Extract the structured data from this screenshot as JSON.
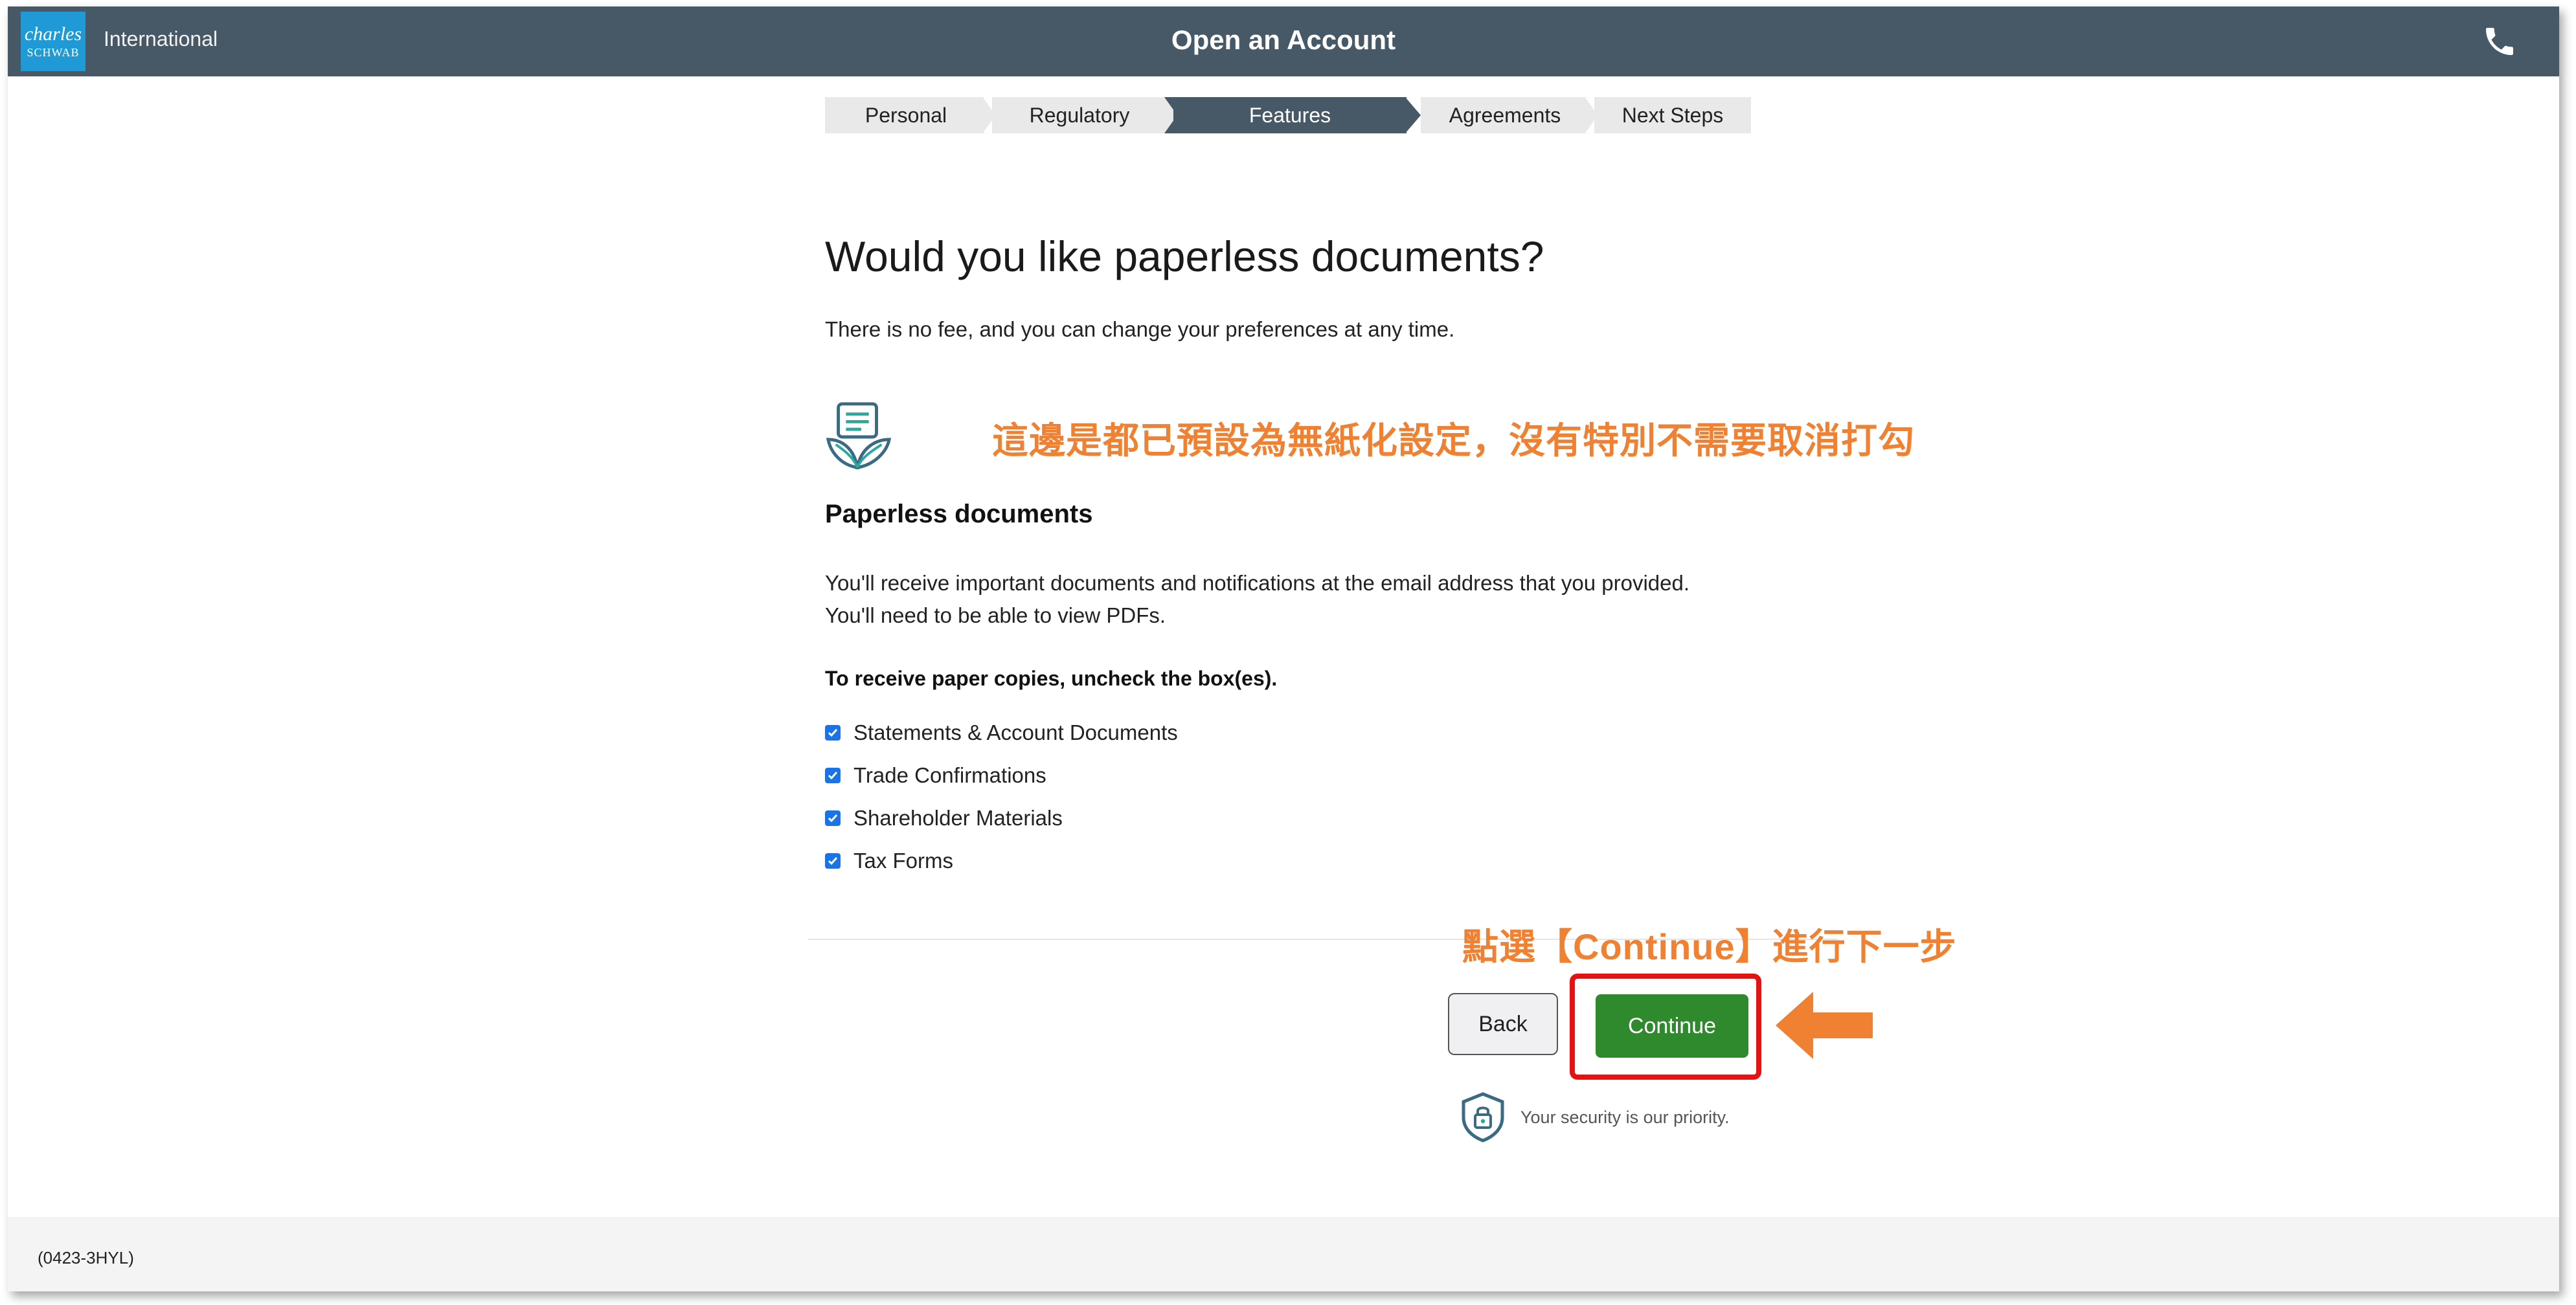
{
  "header": {
    "logo_line1": "charles",
    "logo_line2": "SCHWAB",
    "region": "International",
    "title": "Open an Account",
    "phone_icon": "phone-icon"
  },
  "stepper": {
    "steps": [
      {
        "label": "Personal",
        "active": false
      },
      {
        "label": "Regulatory",
        "active": false
      },
      {
        "label": "Features",
        "active": true
      },
      {
        "label": "Agreements",
        "active": false
      },
      {
        "label": "Next Steps",
        "active": false
      }
    ]
  },
  "main": {
    "question": "Would you like paperless documents?",
    "subtitle": "There is no fee, and you can change your preferences at any time.",
    "annotation_default": "這邊是都已預設為無紙化設定，沒有特別不需要取消打勾",
    "section_title": "Paperless documents",
    "description_line1": "You'll receive important documents and notifications at the email address that you provided.",
    "description_line2": "You'll need to be able to view PDFs.",
    "instruction": "To receive paper copies, uncheck the box(es).",
    "checkboxes": [
      {
        "label": "Statements & Account Documents",
        "checked": true
      },
      {
        "label": "Trade Confirmations",
        "checked": true
      },
      {
        "label": "Shareholder Materials",
        "checked": true
      },
      {
        "label": "Tax Forms",
        "checked": true
      }
    ]
  },
  "actions": {
    "annotation_continue": "點選【Continue】進行下一步",
    "back_label": "Back",
    "continue_label": "Continue",
    "security_text": "Your security is our priority."
  },
  "footer": {
    "code": "(0423-3HYL)"
  },
  "colors": {
    "header_bg": "#475866",
    "logo_bg": "#1f9ad6",
    "continue_green": "#2f8a2d",
    "annotation_orange": "#f08132",
    "highlight_red": "#e41212",
    "checkbox_blue": "#1a73e8"
  }
}
